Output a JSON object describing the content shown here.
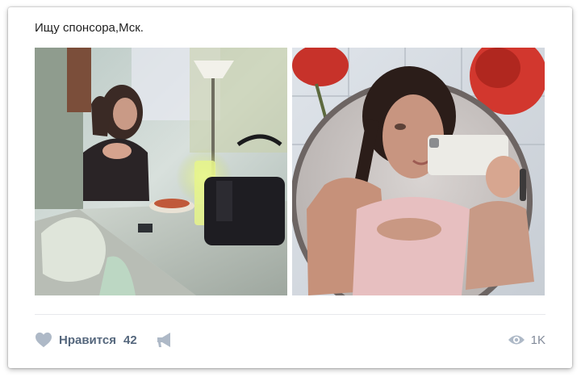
{
  "post": {
    "text": "Ищу спонсора,Мск.",
    "photos": [
      {
        "description_icon": "photo-image"
      },
      {
        "description_icon": "photo-image"
      }
    ]
  },
  "footer": {
    "like_label": "Нравится",
    "like_count": "42",
    "share_icon": "megaphone-icon",
    "views_icon": "eye-icon",
    "views_count": "1K"
  },
  "colors": {
    "action_text": "#55677d",
    "icon": "#aeb9c7",
    "views_text": "#828a99"
  }
}
